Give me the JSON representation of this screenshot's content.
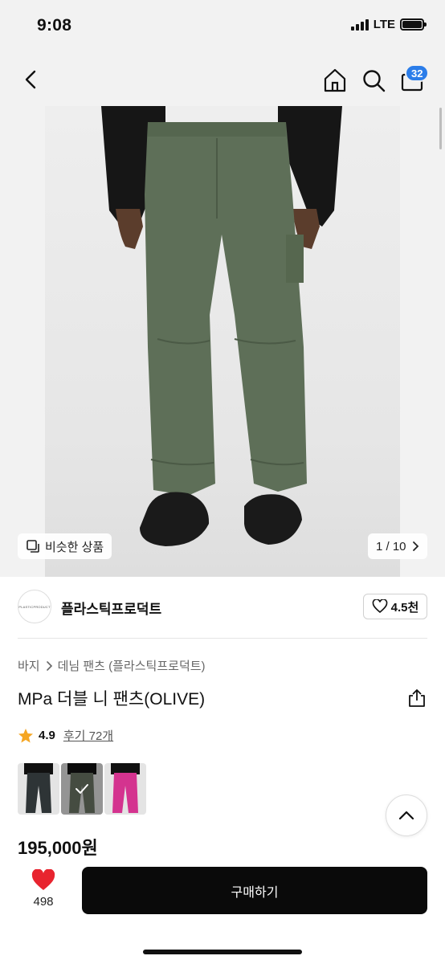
{
  "status_bar": {
    "time": "9:08",
    "network": "LTE"
  },
  "nav": {
    "cart_count": "32",
    "icons": [
      "back-icon",
      "home-icon",
      "search-icon",
      "cart-icon"
    ]
  },
  "hero": {
    "similar_label": "비슷한 상품",
    "pager": "1 / 10",
    "colors": {
      "pants": "#5e6f58",
      "shirt": "#161616",
      "shoes": "#1a1a1a"
    }
  },
  "shop": {
    "logo_text": "PLASTICPRODUCT",
    "name": "플라스틱프로덕트",
    "follow_count": "4.5천"
  },
  "product": {
    "breadcrumb": [
      "바지",
      "데님 팬츠 (플라스틱프로덕트)"
    ],
    "title": "MPa 더블 니 팬츠(OLIVE)",
    "rating": "4.9",
    "review_link": "후기 72개",
    "price": "195,000원",
    "color_options": [
      {
        "name": "black",
        "color": "#2e3436",
        "selected": false
      },
      {
        "name": "olive",
        "color": "#6b7664",
        "selected": true
      },
      {
        "name": "pink",
        "color": "#d4338f",
        "selected": false
      }
    ]
  },
  "bottom": {
    "like_count": "498",
    "buy_label": "구매하기"
  },
  "accent_colors": {
    "badge": "#2b7de9",
    "heart": "#e8242f",
    "star": "#f5a623",
    "buy_button": "#0a0a0a"
  }
}
